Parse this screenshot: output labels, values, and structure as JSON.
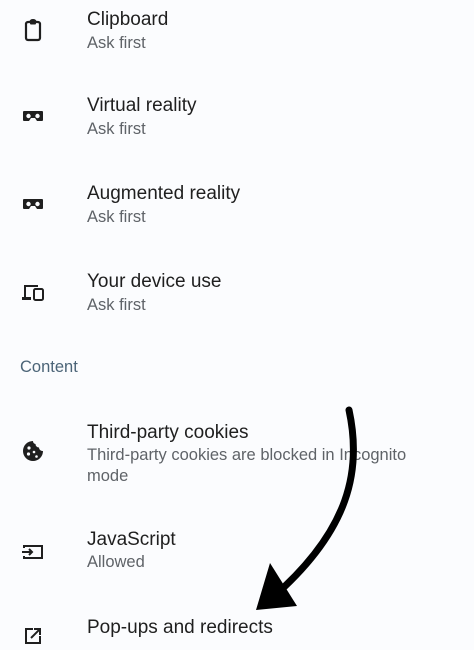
{
  "settings": {
    "items": [
      {
        "title": "Clipboard",
        "subtitle": "Ask first",
        "icon": "clipboard-icon"
      },
      {
        "title": "Virtual reality",
        "subtitle": "Ask first",
        "icon": "vr-headset-icon"
      },
      {
        "title": "Augmented reality",
        "subtitle": "Ask first",
        "icon": "ar-headset-icon"
      },
      {
        "title": "Your device use",
        "subtitle": "Ask first",
        "icon": "devices-icon"
      }
    ],
    "content_header": "Content",
    "content_items": [
      {
        "title": "Third-party cookies",
        "subtitle": "Third-party cookies are blocked in Incognito mode",
        "icon": "cookie-icon"
      },
      {
        "title": "JavaScript",
        "subtitle": "Allowed",
        "icon": "javascript-icon"
      },
      {
        "title": "Pop-ups and redirects",
        "subtitle": "",
        "icon": "open-in-new-icon"
      }
    ]
  },
  "colors": {
    "background": "#fbfcfe",
    "text_primary": "#1f1f1f",
    "text_secondary": "#5f6368",
    "section_header": "#4b6477",
    "arrow": "#000000"
  }
}
